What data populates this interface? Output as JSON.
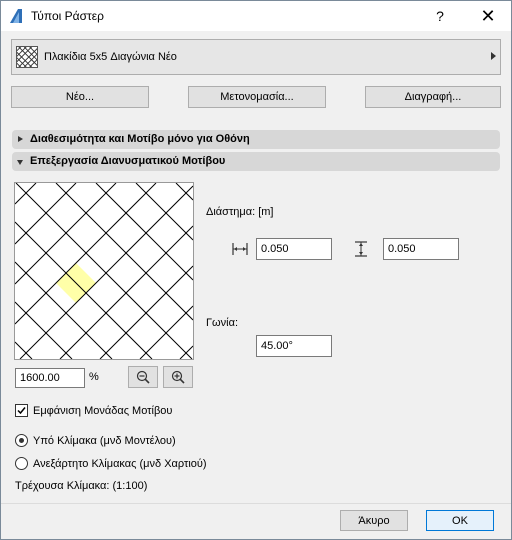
{
  "window": {
    "title": "Τύποι Ράστερ",
    "help_glyph": "?",
    "close_glyph": "✕"
  },
  "selector": {
    "label": "Πλακίδια 5x5 Διαγώνια Νέο",
    "swatch_icon": "crosshatch-swatch-icon"
  },
  "actions": {
    "new_label": "Νέο...",
    "rename_label": "Μετονομασία...",
    "delete_label": "Διαγραφή..."
  },
  "sections": {
    "screen_only": "Διαθεσιμότητα και Μοτίβο μόνο για Οθόνη",
    "vector_edit": "Επεξεργασία Διανυσματικού Μοτίβου"
  },
  "preview": {
    "zoom_value": "1600.00",
    "zoom_unit": "%",
    "highlight_color": "#ffffa8"
  },
  "spacing": {
    "label": "Διάστημα: [m]",
    "horizontal_value": "0.050",
    "vertical_value": "0.050"
  },
  "angle": {
    "label": "Γωνία:",
    "value": "45.00°"
  },
  "options": {
    "show_unit_label": "Εμφάνιση Μονάδας Μοτίβου",
    "show_unit_checked": true,
    "scale_model_label": "Υπό Κλίμακα (μνδ Μοντέλου)",
    "scale_model_selected": true,
    "scale_paper_label": "Ανεξάρτητο Κλίμακας (μνδ Χαρτιού)",
    "current_scale_label": "Τρέχουσα Κλίμακα: (1:100)"
  },
  "footer": {
    "cancel_label": "Άκυρο",
    "ok_label": "OK"
  }
}
